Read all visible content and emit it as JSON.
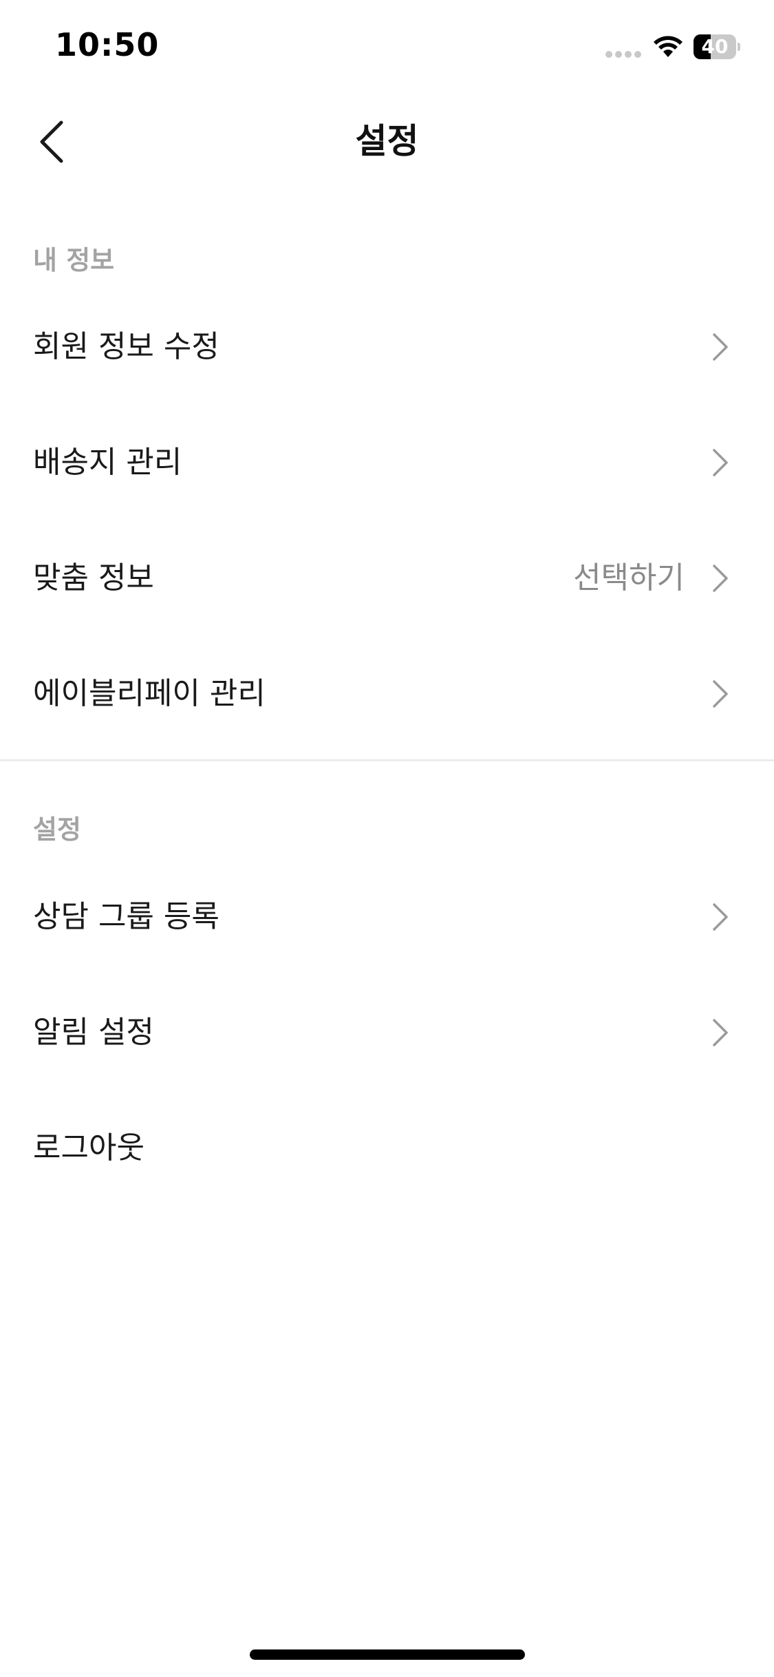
{
  "status_bar": {
    "time": "10:50",
    "battery_level": "40",
    "battery_percent": 40
  },
  "nav": {
    "back_icon": "chevron-left-icon",
    "title": "설정"
  },
  "sections": [
    {
      "header": "내 정보",
      "items": [
        {
          "label": "회원 정보 수정",
          "value": "",
          "chevron": true
        },
        {
          "label": "배송지 관리",
          "value": "",
          "chevron": true
        },
        {
          "label": "맞춤 정보",
          "value": "선택하기",
          "chevron": true
        },
        {
          "label": "에이블리페이 관리",
          "value": "",
          "chevron": true
        }
      ]
    },
    {
      "header": "설정",
      "items": [
        {
          "label": "상담 그룹 등록",
          "value": "",
          "chevron": true
        },
        {
          "label": "알림 설정",
          "value": "",
          "chevron": true
        },
        {
          "label": "로그아웃",
          "value": "",
          "chevron": false
        }
      ]
    }
  ],
  "colors": {
    "text_primary": "#1a1a1a",
    "section_header": "#a3a3a3",
    "value_text": "#8a8a8a",
    "chevron": "#9a9a9a",
    "divider": "#ececec"
  }
}
